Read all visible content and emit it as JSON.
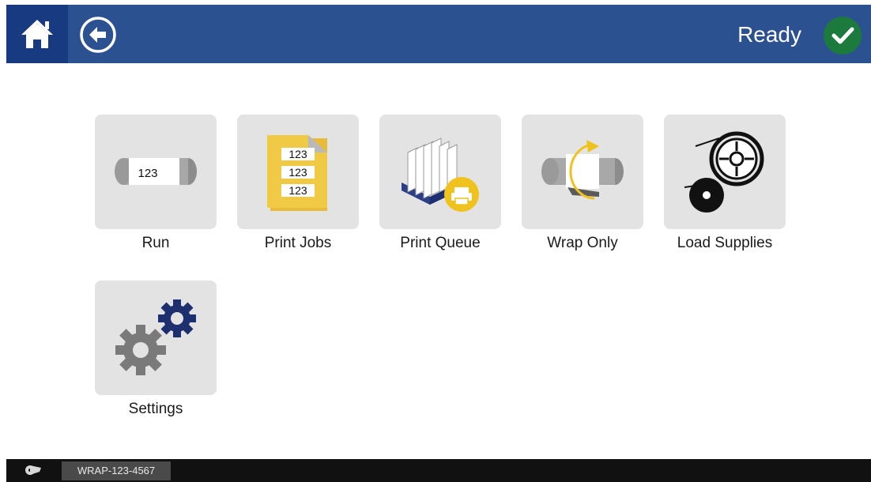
{
  "header": {
    "home_icon": "home-icon",
    "back_icon": "back-arrow-icon",
    "status_text": "Ready",
    "status_icon": "checkmark-icon",
    "status_color": "#1b7a3c",
    "bar_color": "#2b5190",
    "home_color": "#173a80"
  },
  "menu": {
    "tiles": [
      {
        "label": "Run",
        "icon": "run-sleeve-icon",
        "icon_text": "123"
      },
      {
        "label": "Print Jobs",
        "icon": "print-jobs-icon",
        "icon_text": [
          "123",
          "123",
          "123"
        ]
      },
      {
        "label": "Print Queue",
        "icon": "print-queue-icon"
      },
      {
        "label": "Wrap Only",
        "icon": "wrap-only-icon"
      },
      {
        "label": "Load Supplies",
        "icon": "load-supplies-icon"
      },
      {
        "label": "Settings",
        "icon": "settings-gears-icon"
      }
    ]
  },
  "footer": {
    "supply_icon": "tape-roll-icon",
    "device_id": "WRAP-123-4567"
  }
}
